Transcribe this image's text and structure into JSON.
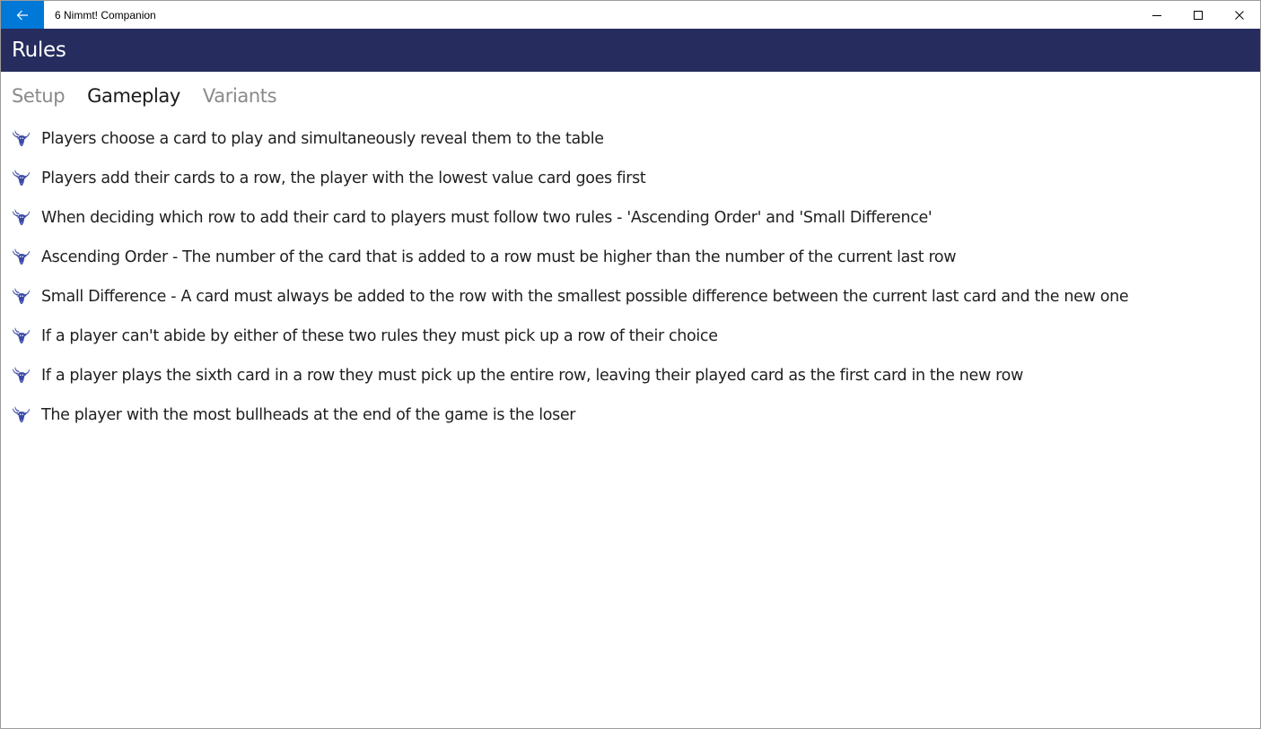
{
  "window": {
    "app_title": "6 Nimmt! Companion"
  },
  "header": {
    "title": "Rules"
  },
  "tabs": [
    {
      "label": "Setup",
      "active": false
    },
    {
      "label": "Gameplay",
      "active": true
    },
    {
      "label": "Variants",
      "active": false
    }
  ],
  "rules": [
    "Players choose a card to play and simultaneously reveal them to the table",
    "Players add their cards to a row, the player with the lowest value card goes first",
    "When deciding which row to add their card to players must follow two rules - 'Ascending Order' and 'Small Difference'",
    "Ascending Order - The number of the card that is added to a row must be higher than the number of the current last row",
    "Small Difference - A card must always be added to the row with the smallest possible difference between the current last card and the new one",
    "If a player can't abide by either of these two rules they must pick up a row of their choice",
    "If a player plays the sixth card in a row they must pick up the entire row, leaving their played card as the first card in the new row",
    "The player with the most bullheads at the end of the game is the loser"
  ],
  "icons": {
    "back": "arrow-left-icon",
    "minimize": "minimize-icon",
    "maximize": "maximize-icon",
    "close": "close-icon",
    "bullet": "bullhead-icon"
  },
  "colors": {
    "accent": "#0078d7",
    "header_bg": "#262c5e",
    "bullhead": "#3b4aa6",
    "tab_inactive": "#8a8a8a",
    "tab_active": "#1a1a1a"
  }
}
